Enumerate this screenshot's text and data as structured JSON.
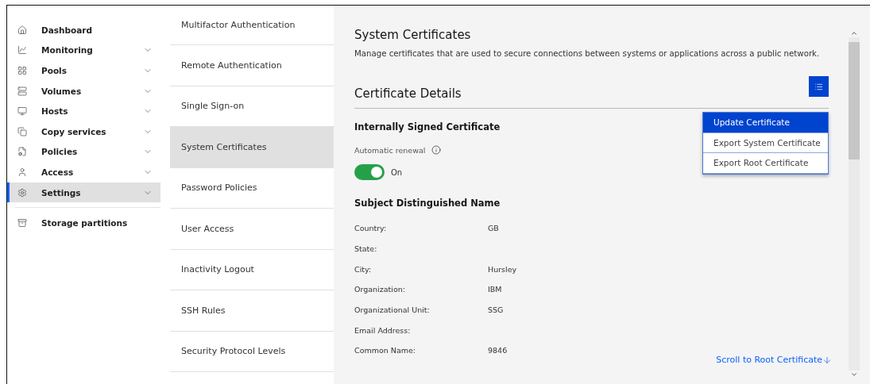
{
  "sidebar": {
    "items": [
      {
        "label": "Dashboard",
        "expandable": false,
        "selected": false
      },
      {
        "label": "Monitoring",
        "expandable": true,
        "selected": false
      },
      {
        "label": "Pools",
        "expandable": true,
        "selected": false
      },
      {
        "label": "Volumes",
        "expandable": true,
        "selected": false
      },
      {
        "label": "Hosts",
        "expandable": true,
        "selected": false
      },
      {
        "label": "Copy services",
        "expandable": true,
        "selected": false
      },
      {
        "label": "Policies",
        "expandable": true,
        "selected": false
      },
      {
        "label": "Access",
        "expandable": true,
        "selected": false
      },
      {
        "label": "Settings",
        "expandable": true,
        "selected": true
      }
    ],
    "bottom_items": [
      {
        "label": "Storage partitions",
        "selected": false
      }
    ]
  },
  "subnav": {
    "items": [
      {
        "label": "Multifactor Authentication",
        "selected": false
      },
      {
        "label": "Remote Authentication",
        "selected": false
      },
      {
        "label": "Single Sign-on",
        "selected": false
      },
      {
        "label": "System Certificates",
        "selected": true
      },
      {
        "label": "Password Policies",
        "selected": false
      },
      {
        "label": "User Access",
        "selected": false
      },
      {
        "label": "Inactivity Logout",
        "selected": false
      },
      {
        "label": "SSH Rules",
        "selected": false
      },
      {
        "label": "Security Protocol Levels",
        "selected": false
      }
    ]
  },
  "main": {
    "title": "System Certificates",
    "description": "Manage certificates that are used to secure connections between systems or applications across a public network.",
    "section_title": "Certificate Details",
    "menu": {
      "open": true,
      "items": [
        {
          "label": "Update Certificate",
          "selected": true
        },
        {
          "label": "Export System Certificate",
          "selected": false
        },
        {
          "label": "Export Root Certificate",
          "selected": false
        }
      ]
    },
    "certificate_title": "Internally Signed Certificate",
    "auto_renewal": {
      "label": "Automatic renewal",
      "on": true,
      "state_label": "On"
    },
    "subject_title": "Subject Distinguished Name",
    "fields": [
      {
        "label": "Country:",
        "value": "GB"
      },
      {
        "label": "State:"
      },
      {
        "label": "City:",
        "value": "Hursley"
      },
      {
        "label": "Organization:",
        "value": "IBM"
      },
      {
        "label": "Organizational Unit:",
        "value": "SSG"
      },
      {
        "label": "Email Address:"
      },
      {
        "label": "Common Name:",
        "value": "9846"
      }
    ],
    "scroll_link": "Scroll to Root Certificate"
  }
}
